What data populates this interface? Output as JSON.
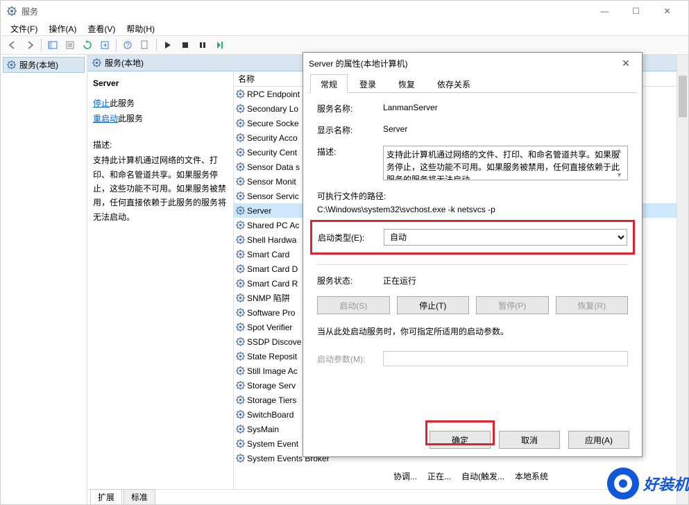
{
  "window": {
    "title": "服务",
    "menus": [
      "文件(F)",
      "操作(A)",
      "查看(V)",
      "帮助(H)"
    ]
  },
  "tree": {
    "root": "服务(本地)"
  },
  "panel": {
    "header": "服务(本地)"
  },
  "detail": {
    "name": "Server",
    "link_stop": "停止",
    "link_stop_suffix": "此服务",
    "link_restart": "重启动",
    "link_restart_suffix": "此服务",
    "desc_label": "描述:",
    "desc_text": "支持此计算机通过网络的文件、打印、和命名管道共享。如果服务停止，这些功能不可用。如果服务被禁用，任何直接依赖于此服务的服务将无法启动。"
  },
  "list": {
    "col_name": "名称",
    "items": [
      "RPC Endpoint",
      "Secondary Lo",
      "Secure Socke",
      "Security Acco",
      "Security Cent",
      "Sensor Data s",
      "Sensor Monit",
      "Sensor Servic",
      "Server",
      "Shared PC Ac",
      "Shell Hardwa",
      "Smart Card",
      "Smart Card D",
      "Smart Card R",
      "SNMP 陷阱",
      "Software Pro",
      "Spot Verifier",
      "SSDP Discove",
      "State Reposit",
      "Still Image Ac",
      "Storage Serv",
      "Storage Tiers",
      "SwitchBoard",
      "SysMain",
      "System Event",
      "System Events Broker"
    ],
    "selected_index": 8,
    "last_cols": [
      "协调...",
      "正在...",
      "自动(触发...",
      "本地系统"
    ]
  },
  "bottom_tabs": {
    "ext": "扩展",
    "std": "标准"
  },
  "dialog": {
    "title": "Server 的属性(本地计算机)",
    "tabs": [
      "常规",
      "登录",
      "恢复",
      "依存关系"
    ],
    "active_tab": 0,
    "labels": {
      "service_name": "服务名称:",
      "display_name": "显示名称:",
      "description": "描述:",
      "exe_path": "可执行文件的路径:",
      "startup_type": "启动类型(E):",
      "service_status": "服务状态:",
      "params": "启动参数(M):",
      "hint": "当从此处启动服务时，你可指定所适用的启动参数。"
    },
    "values": {
      "service_name": "LanmanServer",
      "display_name": "Server",
      "description": "支持此计算机通过网络的文件、打印、和命名管道共享。如果服务停止，这些功能不可用。如果服务被禁用，任何直接依赖于此服务的服务将无法启动",
      "exe_path": "C:\\Windows\\system32\\svchost.exe -k netsvcs -p",
      "startup_type": "自动",
      "service_status": "正在运行"
    },
    "buttons": {
      "start": "启动(S)",
      "stop": "停止(T)",
      "pause": "暂停(P)",
      "resume": "恢复(R)",
      "ok": "确定",
      "cancel": "取消",
      "apply": "应用(A)"
    }
  },
  "watermark": "好装机"
}
